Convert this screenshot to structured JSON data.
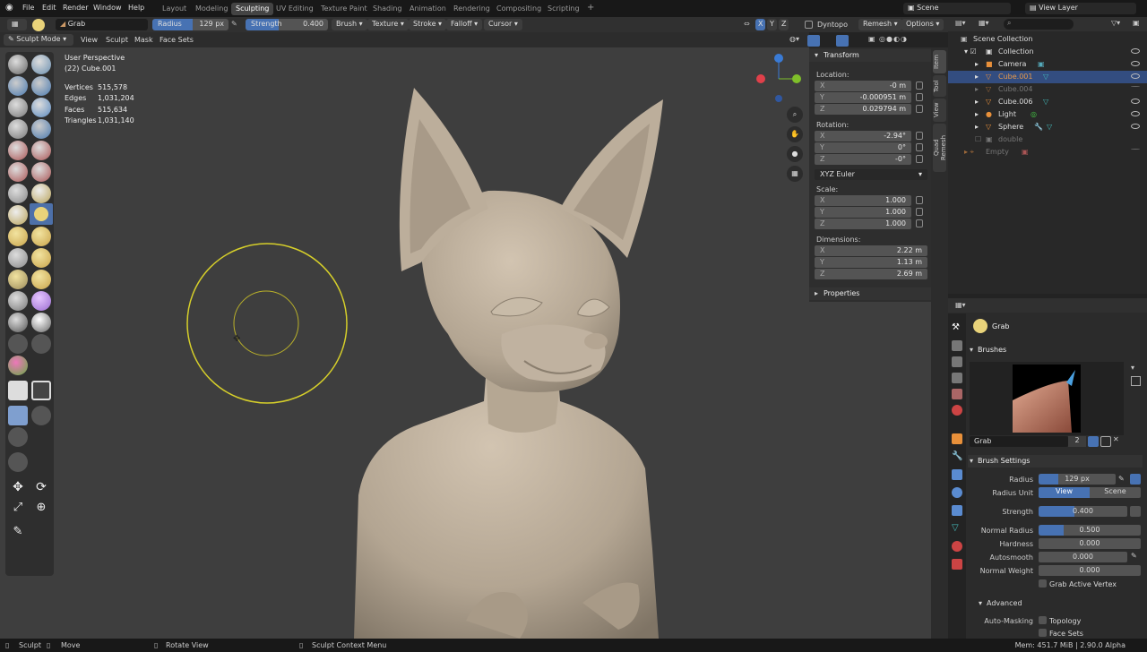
{
  "top_menu": {
    "items": [
      "File",
      "Edit",
      "Render",
      "Window",
      "Help"
    ],
    "workspaces": [
      "Layout",
      "Modeling",
      "Sculpting",
      "UV Editing",
      "Texture Paint",
      "Shading",
      "Animation",
      "Rendering",
      "Compositing",
      "Scripting"
    ],
    "active_workspace": "Sculpting",
    "scene": "Scene",
    "view_layer": "View Layer"
  },
  "tool_header": {
    "brush_name": "Grab",
    "radius_label": "Radius",
    "radius_value": "129 px",
    "strength_label": "Strength",
    "strength_value": "0.400",
    "menus": [
      "Brush",
      "Texture",
      "Stroke",
      "Falloff",
      "Cursor"
    ],
    "xyz": [
      "X",
      "Y",
      "Z"
    ],
    "dyntopo": "Dyntopo",
    "remesh": "Remesh",
    "options": "Options"
  },
  "viewport_header": {
    "mode": "Sculpt Mode",
    "menus": [
      "View",
      "Sculpt",
      "Mask",
      "Face Sets"
    ]
  },
  "overlay_info": {
    "perspective": "User Perspective",
    "object": "(22) Cube.001",
    "stats": [
      {
        "label": "Vertices",
        "value": "515,578"
      },
      {
        "label": "Edges",
        "value": "1,031,204"
      },
      {
        "label": "Faces",
        "value": "515,634"
      },
      {
        "label": "Triangles",
        "value": "1,031,140"
      }
    ]
  },
  "npanel": {
    "tabs": [
      "Item",
      "Tool",
      "View",
      "Quad Remesh"
    ],
    "transform_title": "Transform",
    "location_label": "Location:",
    "location": [
      {
        "k": "X",
        "v": "-0 m"
      },
      {
        "k": "Y",
        "v": "-0.000951 m"
      },
      {
        "k": "Z",
        "v": "0.029794 m"
      }
    ],
    "rotation_label": "Rotation:",
    "rotation": [
      {
        "k": "X",
        "v": "-2.94°"
      },
      {
        "k": "Y",
        "v": "0°"
      },
      {
        "k": "Z",
        "v": "-0°"
      }
    ],
    "rotation_mode": "XYZ Euler",
    "scale_label": "Scale:",
    "scale": [
      {
        "k": "X",
        "v": "1.000"
      },
      {
        "k": "Y",
        "v": "1.000"
      },
      {
        "k": "Z",
        "v": "1.000"
      }
    ],
    "dimensions_label": "Dimensions:",
    "dimensions": [
      {
        "k": "X",
        "v": "2.22 m"
      },
      {
        "k": "Y",
        "v": "1.13 m"
      },
      {
        "k": "Z",
        "v": "2.69 m"
      }
    ],
    "properties_title": "Properties"
  },
  "outliner": {
    "root": "Scene Collection",
    "items": [
      {
        "name": "Collection",
        "indent": 1
      },
      {
        "name": "Camera",
        "indent": 2
      },
      {
        "name": "Cube.001",
        "indent": 2,
        "selected": true
      },
      {
        "name": "Cube.004",
        "indent": 2,
        "dim": true
      },
      {
        "name": "Cube.006",
        "indent": 2
      },
      {
        "name": "Light",
        "indent": 2
      },
      {
        "name": "Sphere",
        "indent": 2
      },
      {
        "name": "double",
        "indent": 2,
        "dim": true
      },
      {
        "name": "Empty",
        "indent": 1,
        "dim": true
      }
    ]
  },
  "properties": {
    "active_tool": "Grab",
    "brushes_title": "Brushes",
    "brush_name": "Grab",
    "brush_users": "2",
    "brush_settings_title": "Brush Settings",
    "rows": [
      {
        "label": "Radius",
        "value": "129 px",
        "fill": 0.25
      },
      {
        "label": "Radius Unit",
        "value": ""
      },
      {
        "label": "Strength",
        "value": "0.400",
        "fill": 0.4
      },
      {
        "label": "Normal Radius",
        "value": "0.500",
        "fill": 0.25
      },
      {
        "label": "Hardness",
        "value": "0.000",
        "fill": 0
      },
      {
        "label": "Autosmooth",
        "value": "0.000",
        "fill": 0
      },
      {
        "label": "Normal Weight",
        "value": "0.000",
        "fill": 0
      }
    ],
    "radius_unit_options": [
      "View",
      "Scene"
    ],
    "grab_active_vertex": "Grab Active Vertex",
    "advanced_title": "Advanced",
    "automasking_label": "Auto-Masking",
    "topology": "Topology",
    "face_sets": "Face Sets"
  },
  "status_bar": {
    "left": [
      "Sculpt",
      "Move",
      "Rotate View",
      "Sculpt Context Menu"
    ],
    "right": "Mem: 451.7 MiB | 2.90.0 Alpha"
  },
  "colors": {
    "accent": "#4772b3",
    "selected_row": "#334d80",
    "brush_circle": "#d6cf2a",
    "model": "#b8aa98"
  }
}
